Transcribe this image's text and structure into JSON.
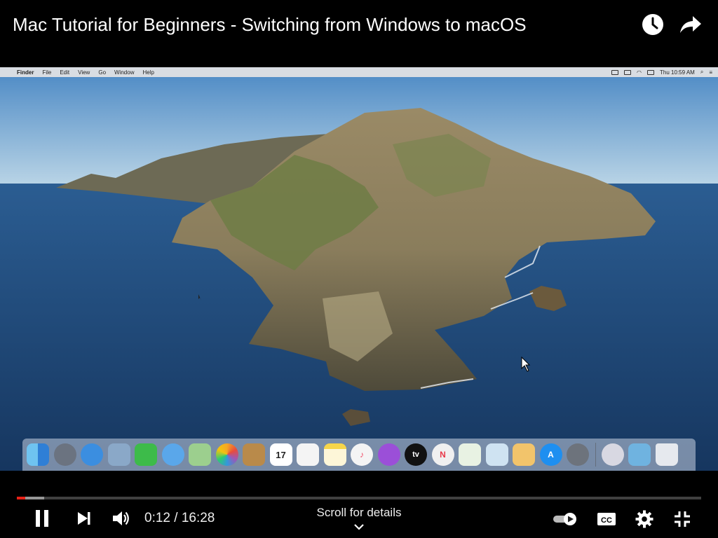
{
  "video": {
    "title": "Mac Tutorial for Beginners - Switching from Windows to macOS"
  },
  "top_actions": {
    "watch_later_icon": "clock-icon",
    "share_icon": "share-arrow-icon"
  },
  "mac_menubar": {
    "apple_glyph": "",
    "app_name": "Finder",
    "items": [
      "File",
      "Edit",
      "View",
      "Go",
      "Window",
      "Help"
    ],
    "clock": "Thu 10:59 AM"
  },
  "dock": {
    "icons": [
      "finder-icon",
      "launchpad-icon",
      "safari-icon",
      "mail-icon",
      "facetime-icon",
      "messages-icon",
      "maps-icon",
      "photos-icon",
      "contacts-icon",
      "calendar-icon",
      "reminders-icon",
      "notes-icon",
      "music-icon",
      "podcasts-icon",
      "apple-tv-icon",
      "news-icon",
      "numbers-icon",
      "keynote-icon",
      "pages-icon",
      "app-store-icon",
      "system-preferences-icon",
      "photo-booth-icon",
      "downloads-folder-icon",
      "trash-icon"
    ],
    "calendar_day": "17",
    "tv_label": "tv"
  },
  "player": {
    "current_time": "0:12",
    "separator": " / ",
    "duration": "16:28",
    "time_text": "0:12 / 16:28",
    "progress_fraction": 0.012,
    "buffered_fraction": 0.04,
    "scroll_hint": "Scroll for details",
    "autoplay_on": true,
    "accent_color": "#e62117"
  }
}
